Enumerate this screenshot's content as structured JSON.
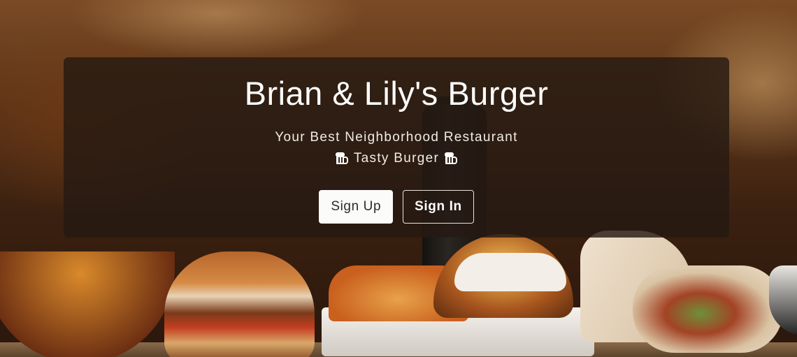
{
  "hero": {
    "title": "Brian & Lily's Burger",
    "subtitle": "Your Best Neighborhood Restaurant",
    "tagline": "Tasty Burger",
    "tagline_icon": "beer-mug-icon"
  },
  "actions": {
    "sign_up_label": "Sign Up",
    "sign_in_label": "Sign In"
  },
  "colors": {
    "overlay": "#261a12",
    "button_light": "#fbfbfa",
    "text": "#ffffff"
  }
}
